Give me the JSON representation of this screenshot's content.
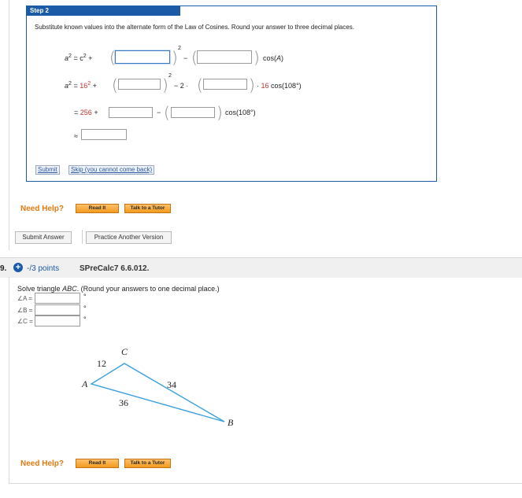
{
  "step": {
    "title": "Step 2",
    "instruction": "Substitute known values into the alternate form of the Law of Cosines. Round your answer to three decimal places.",
    "eq1": {
      "lhs": "a",
      "exp": "2",
      "eq": "= c",
      "exp2": "2",
      "plus": "+",
      "minus": "−",
      "cos": "cos(",
      "A": "A",
      "close": ")"
    },
    "eq2": {
      "lhs": "a",
      "exp": "2",
      "eq": "=",
      "val": "16",
      "exp2": "2",
      "plus": "+",
      "minus": "− 2 ·",
      "dot": "·",
      "coef": "16",
      "cos": "cos(108°)"
    },
    "eq3": {
      "eq": "=",
      "val": "256",
      "plus": "+",
      "minus": "−",
      "cos": "cos(108°)"
    },
    "eq4": {
      "approx": "≈"
    },
    "submit_label": "Submit",
    "skip_label": "Skip (you cannot come back)"
  },
  "help1": {
    "label": "Need Help?",
    "read": "Read It",
    "tutor": "Talk to a Tutor"
  },
  "actions": {
    "submit": "Submit Answer",
    "practice": "Practice Another Version"
  },
  "question": {
    "number": "9.",
    "points": "-/3 points",
    "code": "SPreCalc7 6.6.012.",
    "prompt_pre": "Solve triangle",
    "prompt_tri": "ABC",
    "prompt_post": ". (Round your answers to one decimal place.)",
    "angles": [
      {
        "label": "∠A =",
        "unit": "°"
      },
      {
        "label": "∠B =",
        "unit": "°"
      },
      {
        "label": "∠C =",
        "unit": "°"
      }
    ],
    "triangle": {
      "A": "A",
      "B": "B",
      "C": "C",
      "ac": "12",
      "cb": "34",
      "ab": "36"
    }
  },
  "help2": {
    "label": "Need Help?",
    "read": "Read It",
    "tutor": "Talk to a Tutor"
  },
  "colors": {
    "accent": "#1a5aa6",
    "help": "#e07b12",
    "value": "#c7312f",
    "triangle": "#3aa0df"
  }
}
